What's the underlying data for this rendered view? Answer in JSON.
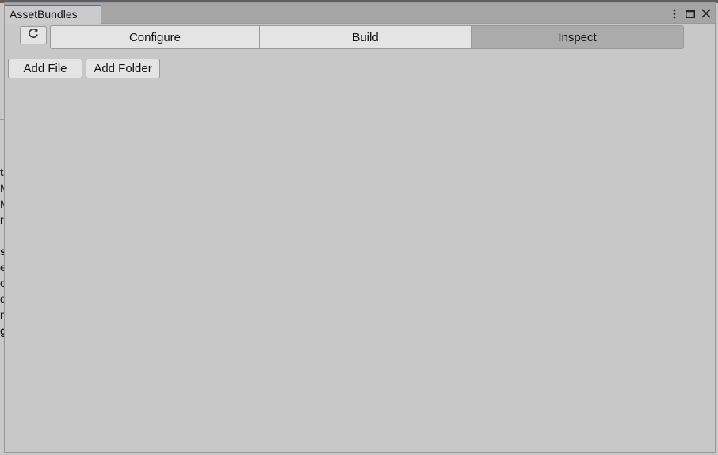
{
  "window": {
    "tab_title": "AssetBundles"
  },
  "window_controls": {
    "menu_icon": "more-vertical-icon",
    "maximize_icon": "maximize-icon",
    "close_icon": "close-icon"
  },
  "toolbar": {
    "refresh_icon": "refresh-icon",
    "tabs": [
      {
        "label": "Configure",
        "active": false
      },
      {
        "label": "Build",
        "active": false
      },
      {
        "label": "Inspect",
        "active": true
      }
    ]
  },
  "actions": {
    "add_file_label": "Add File",
    "add_folder_label": "Add Folder"
  },
  "background_peek": {
    "lines": [
      "t",
      "M",
      "M",
      "r",
      "s",
      "e",
      "o",
      "d",
      "n",
      "g"
    ]
  },
  "colors": {
    "window_bg": "#c8c8c8",
    "tab_accent": "#3a79bb",
    "active_segment": "#ababab",
    "button_bg": "#e4e4e4"
  }
}
